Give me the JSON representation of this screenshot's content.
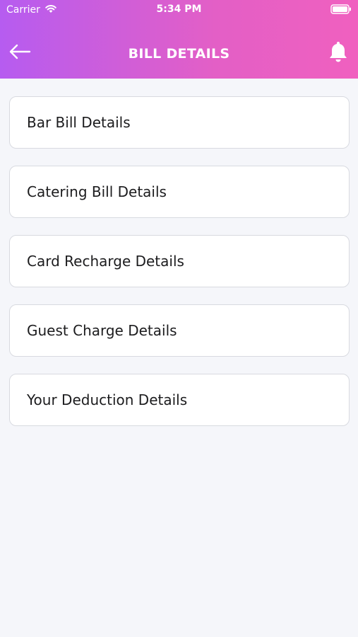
{
  "status_bar": {
    "carrier": "Carrier",
    "time": "5:34 PM",
    "icons": [
      "wifi-icon",
      "battery-icon"
    ]
  },
  "header": {
    "title": "BILL DETAILS",
    "back_icon": "arrow-left-icon",
    "bell_icon": "bell-icon",
    "gradient": [
      "#b65cf0",
      "#f060bf"
    ]
  },
  "items": [
    {
      "label": "Bar Bill Details"
    },
    {
      "label": "Catering Bill Details"
    },
    {
      "label": "Card Recharge Details"
    },
    {
      "label": "Guest Charge Details"
    },
    {
      "label": "Your Deduction Details"
    }
  ]
}
